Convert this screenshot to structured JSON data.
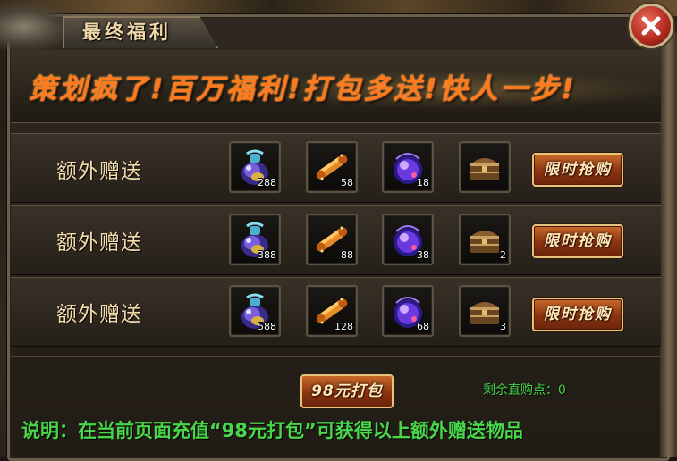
{
  "window": {
    "title": "最终福利",
    "close_icon": "close-icon",
    "accent_color": "#ff7a1e"
  },
  "banner": {
    "text": "策划疯了!百万福利!打包多送!快人一步!"
  },
  "rows": [
    {
      "label": "额外赠送",
      "buy_label": "限时抢购",
      "items": [
        {
          "icon": "potion-jar-icon",
          "count": "288"
        },
        {
          "icon": "scroll-icon",
          "count": "58"
        },
        {
          "icon": "purple-orb-icon",
          "count": "18"
        },
        {
          "icon": "treasure-chest-icon",
          "count": ""
        }
      ]
    },
    {
      "label": "额外赠送",
      "buy_label": "限时抢购",
      "items": [
        {
          "icon": "potion-jar-icon",
          "count": "388"
        },
        {
          "icon": "scroll-icon",
          "count": "88"
        },
        {
          "icon": "purple-orb-icon",
          "count": "38"
        },
        {
          "icon": "treasure-chest-icon",
          "count": "2"
        }
      ]
    },
    {
      "label": "额外赠送",
      "buy_label": "限时抢购",
      "items": [
        {
          "icon": "potion-jar-icon",
          "count": "588"
        },
        {
          "icon": "scroll-icon",
          "count": "128"
        },
        {
          "icon": "purple-orb-icon",
          "count": "68"
        },
        {
          "icon": "treasure-chest-icon",
          "count": "3"
        }
      ]
    }
  ],
  "footer": {
    "pack_button": "98元打包",
    "points_label": "剩余直购点：",
    "points_value": "0",
    "description": "说明：在当前页面充值“98元打包”可获得以上额外赠送物品"
  }
}
